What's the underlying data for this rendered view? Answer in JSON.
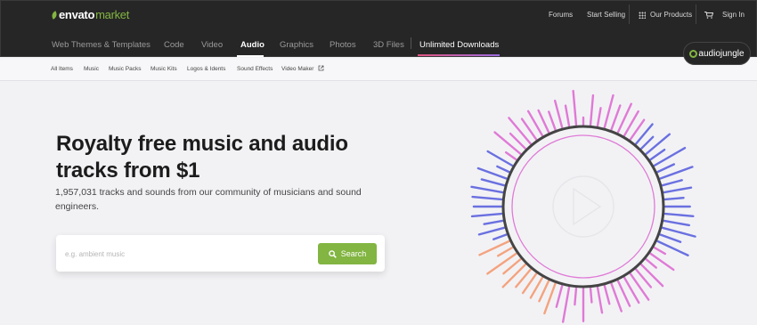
{
  "header": {
    "logo_brand": "envato",
    "logo_sub": "market",
    "links": {
      "forums": "Forums",
      "start_selling": "Start Selling",
      "our_products": "Our Products",
      "sign_in": "Sign In"
    }
  },
  "main_nav": {
    "items": [
      "Web Themes & Templates",
      "Code",
      "Video",
      "Audio",
      "Graphics",
      "Photos",
      "3D Files"
    ],
    "active": "Audio",
    "unlimited": "Unlimited Downloads"
  },
  "badge": {
    "label": "audiojungle"
  },
  "sub_nav": {
    "items": [
      "All Items",
      "Music",
      "Music Packs",
      "Music Kits",
      "Logos & Idents",
      "Sound Effects",
      "Video Maker"
    ]
  },
  "hero": {
    "title": "Royalty free music and audio tracks from $1",
    "subtitle": "1,957,031 tracks and sounds from our community of musicians and sound engineers."
  },
  "search": {
    "placeholder": "e.g. ambient music",
    "button_label": "Search"
  },
  "icons": [
    "grid-icon",
    "cart-icon",
    "external-link-icon",
    "search-icon",
    "play-icon"
  ],
  "colors": {
    "brand_green": "#82b541",
    "topbar": "#262626",
    "viz_pink": "#e07ad6",
    "viz_blue": "#6a70e0",
    "viz_orange": "#f4a37f"
  }
}
